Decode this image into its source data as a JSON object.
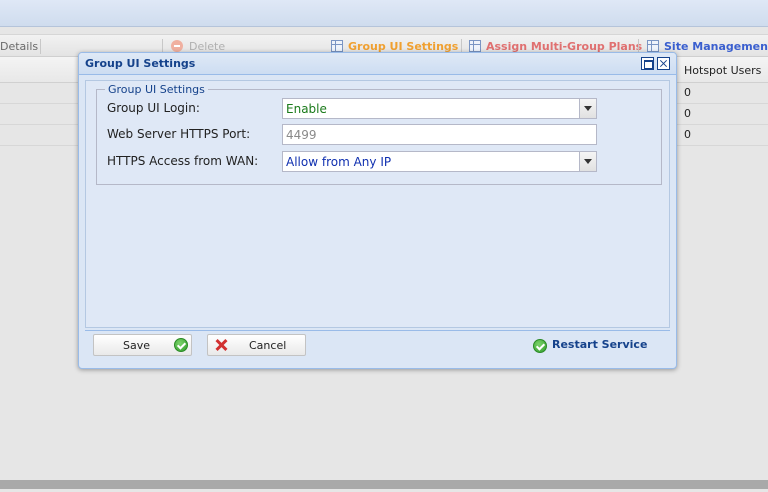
{
  "toolbar": {
    "details_label": "Details",
    "delete_label": "Delete",
    "group_ui_settings_label": "Group UI Settings",
    "assign_plans_label": "Assign Multi-Group Plans",
    "site_management_label": "Site Management"
  },
  "grid": {
    "column_header": "Hotspot Users",
    "rows": [
      "0",
      "0",
      "0"
    ]
  },
  "dialog": {
    "title": "Group UI Settings",
    "fieldset_title": "Group UI Settings",
    "fields": {
      "login_label": "Group UI Login:",
      "login_value": "Enable",
      "port_label": "Web Server HTTPS Port:",
      "port_placeholder": "4499",
      "wan_label": "HTTPS Access from WAN:",
      "wan_value": "Allow from Any IP"
    },
    "buttons": {
      "save": "Save",
      "cancel": "Cancel",
      "restart": "Restart Service"
    }
  },
  "colors": {
    "accent": "#15428b",
    "toolbar_orange": "#f0a030",
    "toolbar_red": "#e07070",
    "toolbar_blue": "#3a5fcf",
    "enable_green": "#1a7a1a",
    "any_ip_blue": "#1030b0"
  }
}
